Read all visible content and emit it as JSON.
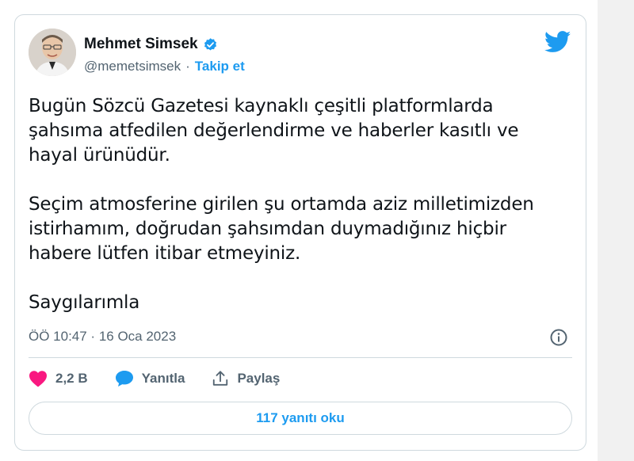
{
  "author": {
    "name": "Mehmet Simsek",
    "handle": "@memetsimsek",
    "separator": "·",
    "follow_label": "Takip et"
  },
  "tweet": {
    "paragraphs": [
      "Bugün Sözcü Gazetesi kaynaklı çeşitli platformlarda şahsıma atfedilen değerlendirme ve haberler kasıtlı ve hayal ürünüdür.",
      "Seçim atmosferine girilen şu ortamda aziz milletimizden istirhamım, doğrudan şahsımdan duymadığınız hiçbir habere lütfen itibar etmeyiniz.",
      "Saygılarımla"
    ],
    "timestamp": "ÖÖ 10:47 · 16 Oca 2023"
  },
  "actions": {
    "like_count": "2,2 B",
    "reply_label": "Yanıtla",
    "share_label": "Paylaş"
  },
  "replies_button_label": "117 yanıtı oku",
  "icons": [
    "verified-icon",
    "twitter-bird-icon",
    "info-icon",
    "heart-icon",
    "reply-bubble-icon",
    "share-icon"
  ],
  "colors": {
    "accent": "#1d9bf0",
    "like": "#f91880",
    "text": "#0f1419",
    "muted": "#536471",
    "border": "#cfd9de"
  }
}
